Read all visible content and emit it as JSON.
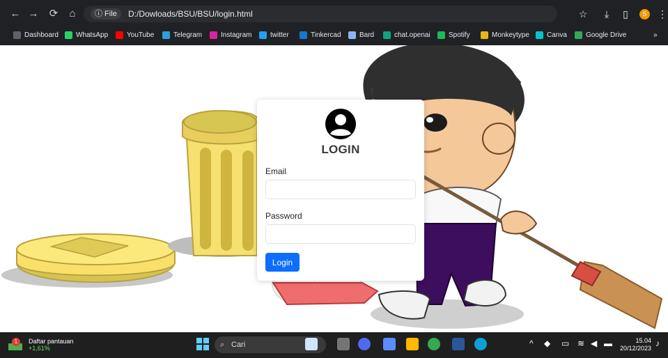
{
  "browser": {
    "nav": {
      "back": "←",
      "forward": "→",
      "reload": "⟳",
      "home": "⌂"
    },
    "address": {
      "file_label": "ⓘ File",
      "url": "D:/Dowloads/BSU/BSU/login.html"
    },
    "actions": {
      "bookmark": "☆",
      "download": "⤓",
      "sidepanel": "▯",
      "profile": "S",
      "menu": "⋮"
    },
    "bookmarks": [
      {
        "label": "Dashboard",
        "color": "#5f6368"
      },
      {
        "label": "WhatsApp",
        "color": "#25d366"
      },
      {
        "label": "YouTube",
        "color": "#ff0000"
      },
      {
        "label": "Telegram",
        "color": "#2aa0da"
      },
      {
        "label": "Instagram",
        "color": "#d6249f"
      },
      {
        "label": "twitter",
        "color": "#1da1f2"
      },
      {
        "label": "Tinkercad",
        "color": "#1477d1"
      },
      {
        "label": "Bard",
        "color": "#8ab4f8"
      },
      {
        "label": "chat.openai",
        "color": "#10a37f"
      },
      {
        "label": "Spotify",
        "color": "#1db954"
      },
      {
        "label": "Monkeytype",
        "color": "#e2b714"
      },
      {
        "label": "Canva",
        "color": "#00c4cc"
      },
      {
        "label": "Google Drive",
        "color": "#34a853"
      }
    ],
    "bookmarks_more": "»"
  },
  "login": {
    "title": "LOGIN",
    "email_label": "Email",
    "email_value": "",
    "password_label": "Password",
    "password_value": "",
    "submit": "Login"
  },
  "taskbar": {
    "watchlist_title": "Daftar pantauan",
    "watchlist_change": "+1,61%",
    "badge": "1",
    "search_placeholder": "Cari",
    "clock_time": "15.04",
    "clock_date": "20/12/2023",
    "tray_up": "^"
  },
  "colors": {
    "chrome_bg": "#202124",
    "taskbar_bg": "#1f1f1f",
    "primary_button": "#0d6efd"
  }
}
